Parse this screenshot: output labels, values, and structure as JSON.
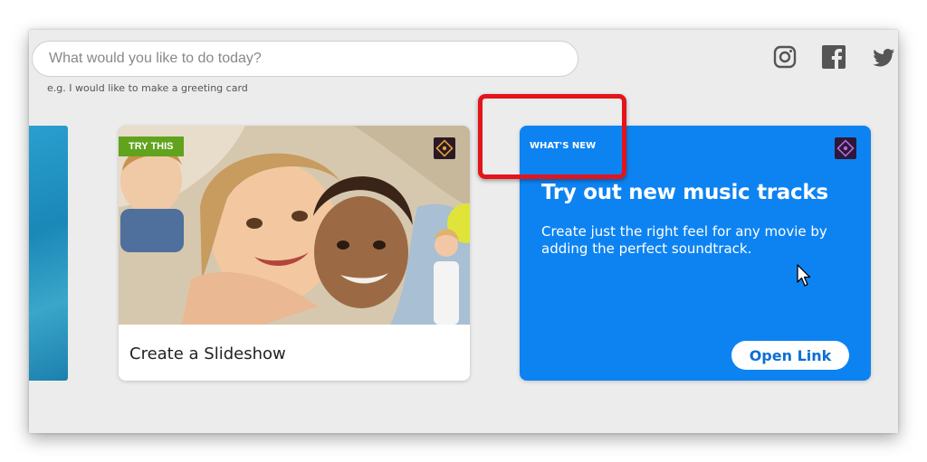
{
  "search": {
    "placeholder": "What would you like to do today?",
    "hint": "e.g. I would like to make a greeting card"
  },
  "social": {
    "icons": [
      "instagram-icon",
      "facebook-icon",
      "twitter-icon"
    ]
  },
  "cards": {
    "slideshow": {
      "badge": "TRY THIS",
      "title": "Create a Slideshow",
      "icon": "premiere-elements-icon"
    },
    "music": {
      "badge": "WHAT'S NEW",
      "title": "Try out new music tracks",
      "description": "Create just the right feel for any movie by adding the perfect soundtrack.",
      "button": "Open Link",
      "icon": "premiere-elements-icon"
    }
  },
  "colors": {
    "window_bg": "#ececec",
    "accent_blue": "#0d83f2",
    "badge_green": "#61a31d",
    "highlight_red": "#e3141a"
  }
}
